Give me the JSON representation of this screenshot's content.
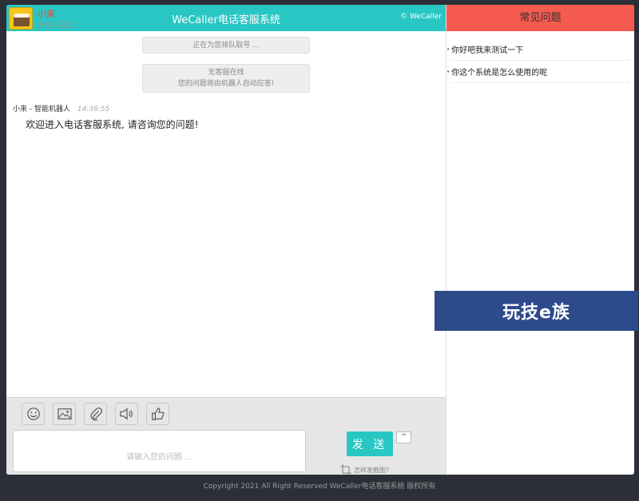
{
  "header": {
    "agent_name": "小来",
    "agent_role": "智能机器人",
    "title": "WeCaller电话客服系统",
    "brand": "© WeCaller"
  },
  "notices": {
    "queue": "正在为您排队取号 ...",
    "offline_line1": "无客服在线",
    "offline_line2": "您的问题将由机器人自动应答!"
  },
  "message": {
    "sender": "小来 - 智能机器人",
    "time": "14:36:55",
    "text": "欢迎进入电话客服系统, 请咨询您的问题!"
  },
  "toolbar": {
    "icons": [
      "emoji-icon",
      "image-icon",
      "attachment-icon",
      "volume-icon",
      "thumbs-up-icon"
    ]
  },
  "composer": {
    "placeholder": "请输入您的问题 ...",
    "send_label": "发 送",
    "expand_label": "^",
    "screenshot_help": "怎样发截图?"
  },
  "faq": {
    "title": "常见问题",
    "items": [
      "你好吧我来测试一下",
      "你这个系统是怎么使用的呢"
    ]
  },
  "footer": {
    "copyright": "Copyright 2021 All Right Reserved WeCaller电话客服系统 版权所有"
  },
  "watermark": {
    "text": "玩技e族"
  },
  "colors": {
    "accent": "#28c7c4",
    "faq_header": "#f55a4e",
    "background": "#2d2f38"
  }
}
